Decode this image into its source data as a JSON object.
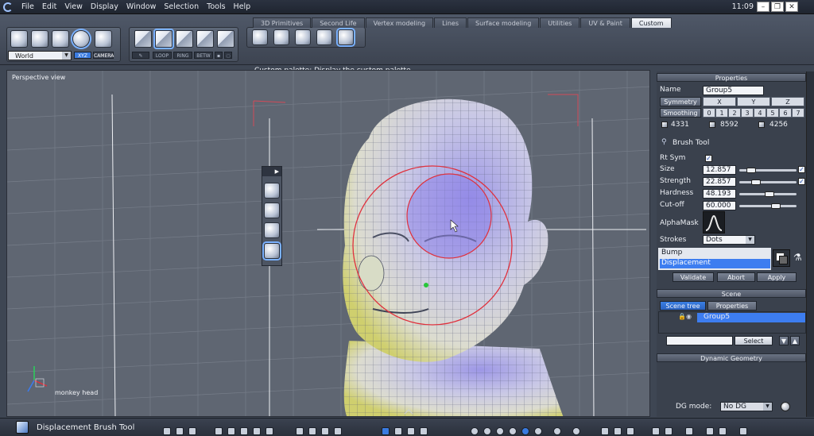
{
  "menubar": {
    "items": [
      "File",
      "Edit",
      "View",
      "Display",
      "Window",
      "Selection",
      "Tools",
      "Help"
    ],
    "clock": "11:09"
  },
  "tabs": [
    "3D Primitives",
    "Second Life",
    "Vertex modeling",
    "Lines",
    "Surface modeling",
    "Utilities",
    "UV & Paint",
    "Custom"
  ],
  "active_tab": "Custom",
  "toolbar": {
    "coord_space": "World",
    "xyz_label": "XYZ",
    "camera_label": "CAMERA",
    "loop_label": "LOOP",
    "ring_label": "RING",
    "betw_label": "BETW",
    "palette_description": "Custom palette: Display the custom palette"
  },
  "viewport": {
    "label": "Perspective view",
    "scene_label": "monkey head"
  },
  "properties": {
    "title": "Properties",
    "name_label": "Name",
    "name_value": "Group5",
    "symmetry_label": "Symmetry",
    "axes": [
      "X",
      "Y",
      "Z"
    ],
    "smoothing_label": "Smoothing",
    "smoothing_levels": [
      "0",
      "1",
      "2",
      "3",
      "4",
      "5",
      "6",
      "7"
    ],
    "stats": [
      "4331",
      "8592",
      "4256"
    ],
    "tool_name": "Brush Tool",
    "rt_sym_label": "Rt Sym",
    "rt_sym_checked": true,
    "params": [
      {
        "label": "Size",
        "value": "12.857",
        "level": 0.13,
        "locked": true
      },
      {
        "label": "Strength",
        "value": "22.857",
        "level": 0.23,
        "locked": true
      },
      {
        "label": "Hardness",
        "value": "48.193",
        "level": 0.48,
        "locked": false
      },
      {
        "label": "Cut-off",
        "value": "60.000",
        "level": 0.6,
        "locked": false
      }
    ],
    "alphamask_label": "AlphaMask",
    "strokes_label": "Strokes",
    "strokes_value": "Dots",
    "modes": [
      "Bump",
      "Displacement"
    ],
    "selected_mode": "Displacement",
    "buttons": {
      "validate": "Validate",
      "abort": "Abort",
      "apply": "Apply"
    }
  },
  "scene": {
    "title": "Scene",
    "tabs": [
      "Scene tree",
      "Properties"
    ],
    "active_tab": "Scene tree",
    "items": [
      "Group5"
    ],
    "select_button": "Select"
  },
  "dynamic_geometry": {
    "title": "Dynamic Geometry",
    "mode_label": "DG mode:",
    "mode_value": "No DG"
  },
  "statusbar": {
    "text": "Displacement Brush Tool"
  },
  "colors": {
    "accent": "#3a7be0",
    "selection": "#3d7df0",
    "brush_circle": "#e0303c",
    "viewport_bg": "#5f6672"
  }
}
